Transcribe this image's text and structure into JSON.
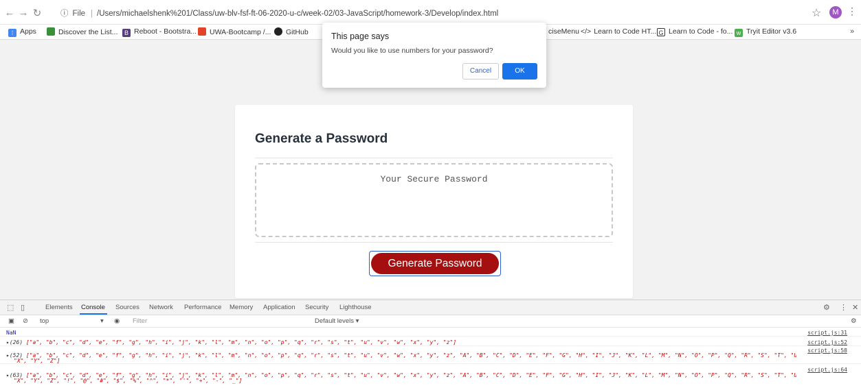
{
  "browser": {
    "back_icon": "arrow-left-icon",
    "forward_icon": "arrow-right-icon",
    "reload_icon": "reload-icon",
    "url_scheme": "File",
    "url": "/Users/michaelshenk%201/Class/uw-blv-fsf-ft-06-2020-u-c/week-02/03-JavaScript/homework-3/Develop/index.html",
    "avatar_letter": "M"
  },
  "bookmarks": [
    {
      "label": "Apps",
      "color": "#4285f4"
    },
    {
      "label": "Discover the List...",
      "color": "#3a8f3a"
    },
    {
      "label": "Reboot - Bootstra...",
      "color": "#563d7c"
    },
    {
      "label": "UWA-Bootcamp /...",
      "color": "#e24329"
    },
    {
      "label": "GitHub",
      "color": "#222222"
    },
    {
      "label": "ciseMenu",
      "color": ""
    },
    {
      "label": "Learn to Code HT...",
      "color": "#333333"
    },
    {
      "label": "Learn to Code - fo...",
      "color": "#333333"
    },
    {
      "label": "Tryit Editor v3.6",
      "color": "#4caf50"
    }
  ],
  "dialog": {
    "title": "This page says",
    "message": "Would you like to use numbers for your password?",
    "cancel_label": "Cancel",
    "ok_label": "OK"
  },
  "card": {
    "title": "Generate a Password",
    "placeholder": "Your Secure Password",
    "button_label": "Generate Password"
  },
  "devtools": {
    "tabs": [
      "Elements",
      "Console",
      "Sources",
      "Network",
      "Performance",
      "Memory",
      "Application",
      "Security",
      "Lighthouse"
    ],
    "active_tab": "Console",
    "context": "top",
    "filter_placeholder": "Filter",
    "levels": "Default levels ▾",
    "console_lines": [
      {
        "text": "NaN",
        "source": "script.js:31"
      },
      {
        "count": "(26)",
        "text": "[\"a\", \"b\", \"c\", \"d\", \"e\", \"f\", \"g\", \"h\", \"i\", \"j\", \"k\", \"l\", \"m\", \"n\", \"o\", \"p\", \"q\", \"r\", \"s\", \"t\", \"u\", \"v\", \"w\", \"x\", \"y\", \"z\"]",
        "source": "script.js:52"
      },
      {
        "count": "(52)",
        "text": "[\"a\", \"b\", \"c\", \"d\", \"e\", \"f\", \"g\", \"h\", \"i\", \"j\", \"k\", \"l\", \"m\", \"n\", \"o\", \"p\", \"q\", \"r\", \"s\", \"t\", \"u\", \"v\", \"w\", \"x\", \"y\", \"z\", \"A\", \"B\", \"C\", \"D\", \"E\", \"F\", \"G\", \"H\", \"I\", \"J\", \"K\", \"L\", \"M\", \"N\", \"O\", \"P\", \"Q\", \"R\", \"S\", \"T\", \"U\", \"V\", \"W\",",
        "text2": "\"X\", \"Y\", \"Z\"]",
        "source": "script.js:58"
      },
      {
        "count": "(63)",
        "text": "[\"a\", \"b\", \"c\", \"d\", \"e\", \"f\", \"g\", \"h\", \"i\", \"j\", \"k\", \"l\", \"m\", \"n\", \"o\", \"p\", \"q\", \"r\", \"s\", \"t\", \"u\", \"v\", \"w\", \"x\", \"y\", \"z\", \"A\", \"B\", \"C\", \"D\", \"E\", \"F\", \"G\", \"H\", \"I\", \"J\", \"K\", \"L\", \"M\", \"N\", \"O\", \"P\", \"Q\", \"R\", \"S\", \"T\", \"U\", \"V\", \"W\",",
        "text2": "\"X\", \"Y\", \"Z\", \"!\", \"@\", \"#\", \"$\", \"%\", \"^\", \"*\", \"'\", \"+\", \"-\", \"_\"]",
        "source": "script.js:64"
      }
    ]
  }
}
